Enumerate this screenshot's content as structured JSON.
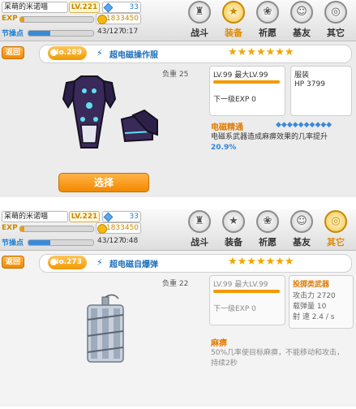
{
  "screens": [
    {
      "player": {
        "name": "呆萌的米诺喵",
        "level": "LV.221",
        "gems": "33",
        "exp_label": "EXP",
        "exp_fraction": 0.05,
        "coins": "11833450",
        "action_label": "节操点",
        "action_value": "43/127",
        "action_timer": "0:17",
        "action_fraction": 0.34
      },
      "nav": [
        {
          "label": "战斗",
          "icon": "castle-icon"
        },
        {
          "label": "装备",
          "icon": "star-icon"
        },
        {
          "label": "祈愿",
          "icon": "swirl-icon"
        },
        {
          "label": "基友",
          "icon": "friend-icon"
        },
        {
          "label": "其它",
          "icon": "spiral-icon"
        }
      ],
      "active_nav": 1,
      "back_label": "返回",
      "item": {
        "number": "No.289",
        "name": "超电磁操作服",
        "stars": "★★★★★★★",
        "weight": "负重 25",
        "level": "LV.99 最大LV.99",
        "level_fraction": 1.0,
        "next_exp": "下一级EXP 0",
        "stat_title": "服装",
        "stat_value": "HP 3799"
      },
      "skill": {
        "name": "电磁精通",
        "diamonds": "◆◆◆◆◆◆◆◆◆◆",
        "description": "电磁系武器造成麻痹效果的几率提升",
        "value": "20.9%"
      },
      "select_label": "选择"
    },
    {
      "player": {
        "name": "呆萌的米诺喵",
        "level": "LV.221",
        "gems": "33",
        "exp_label": "EXP",
        "exp_fraction": 0.05,
        "coins": "11833450",
        "action_label": "节操点",
        "action_value": "43/127",
        "action_timer": "0:48",
        "action_fraction": 0.34
      },
      "nav": [
        {
          "label": "战斗",
          "icon": "castle-icon"
        },
        {
          "label": "装备",
          "icon": "star-icon"
        },
        {
          "label": "祈愿",
          "icon": "swirl-icon"
        },
        {
          "label": "基友",
          "icon": "friend-icon"
        },
        {
          "label": "其它",
          "icon": "spiral-icon"
        }
      ],
      "active_nav": 4,
      "back_label": "返回",
      "item": {
        "number": "No.273",
        "name": "超电磁自爆弹",
        "stars": "★★★★★★★",
        "weight": "负重 22",
        "level": "LV.99 最大LV.99",
        "level_fraction": 1.0,
        "next_exp": "下一级EXP 0",
        "stat_title": "投掷类武器",
        "stat_lines": [
          "攻击力 2720",
          "载弹量 10",
          "射 速 2.4 / s"
        ]
      },
      "skill": {
        "name": "麻痹",
        "description": "50%几率使目标麻痹，不能移动和攻击，持续2秒"
      }
    }
  ],
  "colors": {
    "accent": "#f29a00",
    "link_blue": "#1e6fb8",
    "skill_orange": "#e07b00"
  }
}
